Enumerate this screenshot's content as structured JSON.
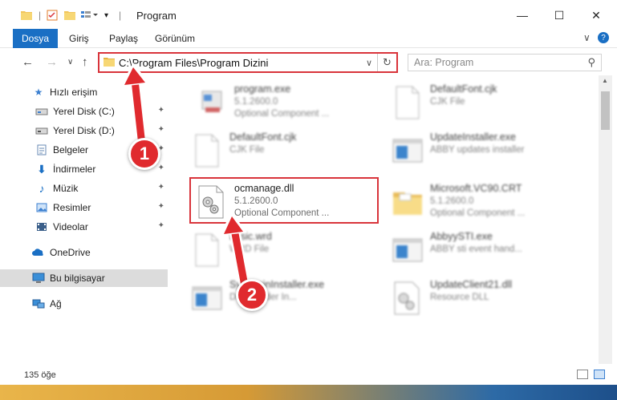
{
  "window": {
    "title": "Program",
    "controls": {
      "minimize": "—",
      "maximize": "☐",
      "close": "✕"
    }
  },
  "ribbon": {
    "file_tab": "Dosya",
    "tabs": [
      "Giriş",
      "Paylaş",
      "Görünüm"
    ],
    "collapse_glyph": "∨",
    "help_glyph": "?"
  },
  "navigation": {
    "back": "←",
    "forward": "→",
    "recent": "∨",
    "up": "↑",
    "address_path": "C:\\Program Files\\Program Dizini",
    "address_dropdown": "∨",
    "refresh": "↻",
    "search_placeholder": "Ara: Program",
    "search_glyph": "⚲"
  },
  "nav_pane": {
    "quick_access": "Hızlı erişim",
    "items": [
      {
        "label": "Yerel Disk (C:)",
        "icon": "drive-icon",
        "pinned": true
      },
      {
        "label": "Yerel Disk (D:)",
        "icon": "drive-icon",
        "pinned": true
      },
      {
        "label": "Belgeler",
        "icon": "documents-icon",
        "pinned": true
      },
      {
        "label": "İndirmeler",
        "icon": "download-icon",
        "pinned": true
      },
      {
        "label": "Müzik",
        "icon": "music-icon",
        "pinned": true
      },
      {
        "label": "Resimler",
        "icon": "pictures-icon",
        "pinned": true
      },
      {
        "label": "Videolar",
        "icon": "videos-icon",
        "pinned": true
      }
    ],
    "onedrive": "OneDrive",
    "this_pc": "Bu bilgisayar",
    "network": "Ağ",
    "pin_glyph": "📌"
  },
  "files": [
    {
      "name": "program.exe",
      "line2": "5.1.2600.0",
      "line3": "Optional Component ...",
      "kind": "exe",
      "blurred": true
    },
    {
      "name": "DefaultFont.cjk",
      "line2": "CJK File",
      "line3": "",
      "kind": "doc",
      "blurred": true
    },
    {
      "name": "DefaultFont.cjk",
      "line2": "CJK File",
      "line3": "",
      "kind": "doc",
      "blurred": true
    },
    {
      "name": "UpdateInstaller.exe",
      "line2": "ABBY updates installer",
      "line3": "",
      "kind": "app",
      "blurred": true
    },
    {
      "name": "ocmanage.dll",
      "line2": "5.1.2600.0",
      "line3": "Optional Component ...",
      "kind": "dll",
      "blurred": false
    },
    {
      "name": "Microsoft.VC90.CRT",
      "line2": "5.1.2600.0",
      "line3": "Optional Component ...",
      "kind": "folder",
      "blurred": true
    },
    {
      "name": "basic.wrd",
      "line2": "WRD File",
      "line3": "",
      "kind": "doc",
      "blurred": true
    },
    {
      "name": "AbbyySTI.exe",
      "line2": "ABBY sti event hand...",
      "line3": "",
      "kind": "app",
      "blurred": true
    },
    {
      "name": "SysteminInstaller.exe",
      "line2": "Downloader In...",
      "line3": "",
      "kind": "app",
      "blurred": true
    },
    {
      "name": "UpdateClient21.dll",
      "line2": "Resource DLL",
      "line3": "",
      "kind": "dll",
      "blurred": true
    }
  ],
  "status": {
    "item_count": "135 öğe"
  },
  "annotations": {
    "step1": "1",
    "step2": "2"
  },
  "colors": {
    "accent": "#1a6fc4",
    "highlight": "#d9343b",
    "callout": "#e02a2e"
  }
}
